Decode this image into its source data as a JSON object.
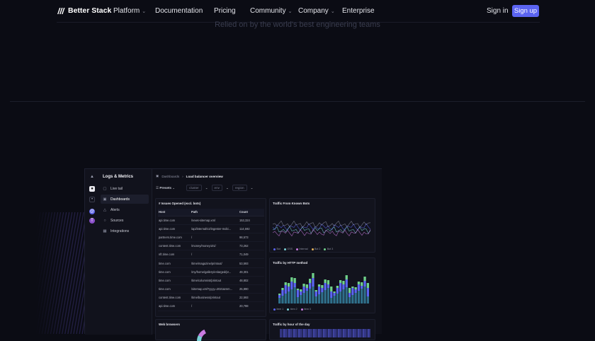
{
  "nav": {
    "brand": "Better Stack",
    "items": [
      {
        "label": "Platform",
        "dropdown": true
      },
      {
        "label": "Documentation",
        "dropdown": false
      },
      {
        "label": "Pricing",
        "dropdown": false
      },
      {
        "label": "Community",
        "dropdown": true
      },
      {
        "label": "Company",
        "dropdown": true
      },
      {
        "label": "Enterprise",
        "dropdown": false
      }
    ],
    "sign_in": "Sign in",
    "sign_up": "Sign up"
  },
  "hero": {
    "tagline": "Relied on by the world's best engineering teams"
  },
  "colors": {
    "accent": "#5b64f1",
    "background": "#0b0c14"
  },
  "app": {
    "sidebar": {
      "title": "Logs & Metrics",
      "items": [
        {
          "label": "Live tail",
          "icon": "live-tail-icon"
        },
        {
          "label": "Dashboards",
          "icon": "dashboard-icon",
          "active": true
        },
        {
          "label": "Alerts",
          "icon": "alert-icon"
        },
        {
          "label": "Sources",
          "icon": "sources-icon"
        },
        {
          "label": "Integrations",
          "icon": "integrations-icon"
        }
      ]
    },
    "breadcrumb": {
      "parent": "Dashboards",
      "current": "Load balancer overview"
    },
    "filters": {
      "presets": "Presets",
      "chips": [
        "cluster",
        "env",
        "region"
      ]
    },
    "issues": {
      "title": "# Issues Opened (excl. bots)",
      "columns": [
        "Host",
        "Path",
        "Count"
      ],
      "rows": [
        [
          "api.time.com",
          "/news-sitemap.xml",
          "153,324"
        ],
        [
          "api.time.com",
          "/api/internal/v2/ingester-mobi...",
          "114,692"
        ],
        [
          "partners.time.com",
          "/",
          "98,573"
        ],
        [
          "content.time.com",
          "/money/money101/",
          "73,262"
        ],
        [
          "nft.time.com",
          "/",
          "71,049"
        ],
        [
          "time.com",
          "/time/magazine/printout/",
          "53,593"
        ],
        [
          "time.com",
          "/my/home/gallery/enlarged/pr...",
          "49,301"
        ],
        [
          "time.com",
          "/time/columnist/printout",
          "48,802"
        ],
        [
          "time.com",
          "/sitemap.xml?yyyy=2021&mm...",
          "25,890"
        ],
        [
          "content.time.com",
          "/time/business/printout",
          "22,593"
        ],
        [
          "api.time.com",
          "/",
          "20,788"
        ]
      ]
    },
    "bots": {
      "title": "Traffic From Known Bots",
      "legend": [
        "Bot",
        "OSS",
        "Internal",
        "Bot 2",
        "Bot 3"
      ]
    },
    "http": {
      "title": "Traffic by HTTP method",
      "legend": [
        "item 1",
        "item 2",
        "item 3"
      ]
    },
    "browsers": {
      "title": "Web browsers"
    },
    "hourly": {
      "title": "Traffic by hour of the day"
    }
  }
}
